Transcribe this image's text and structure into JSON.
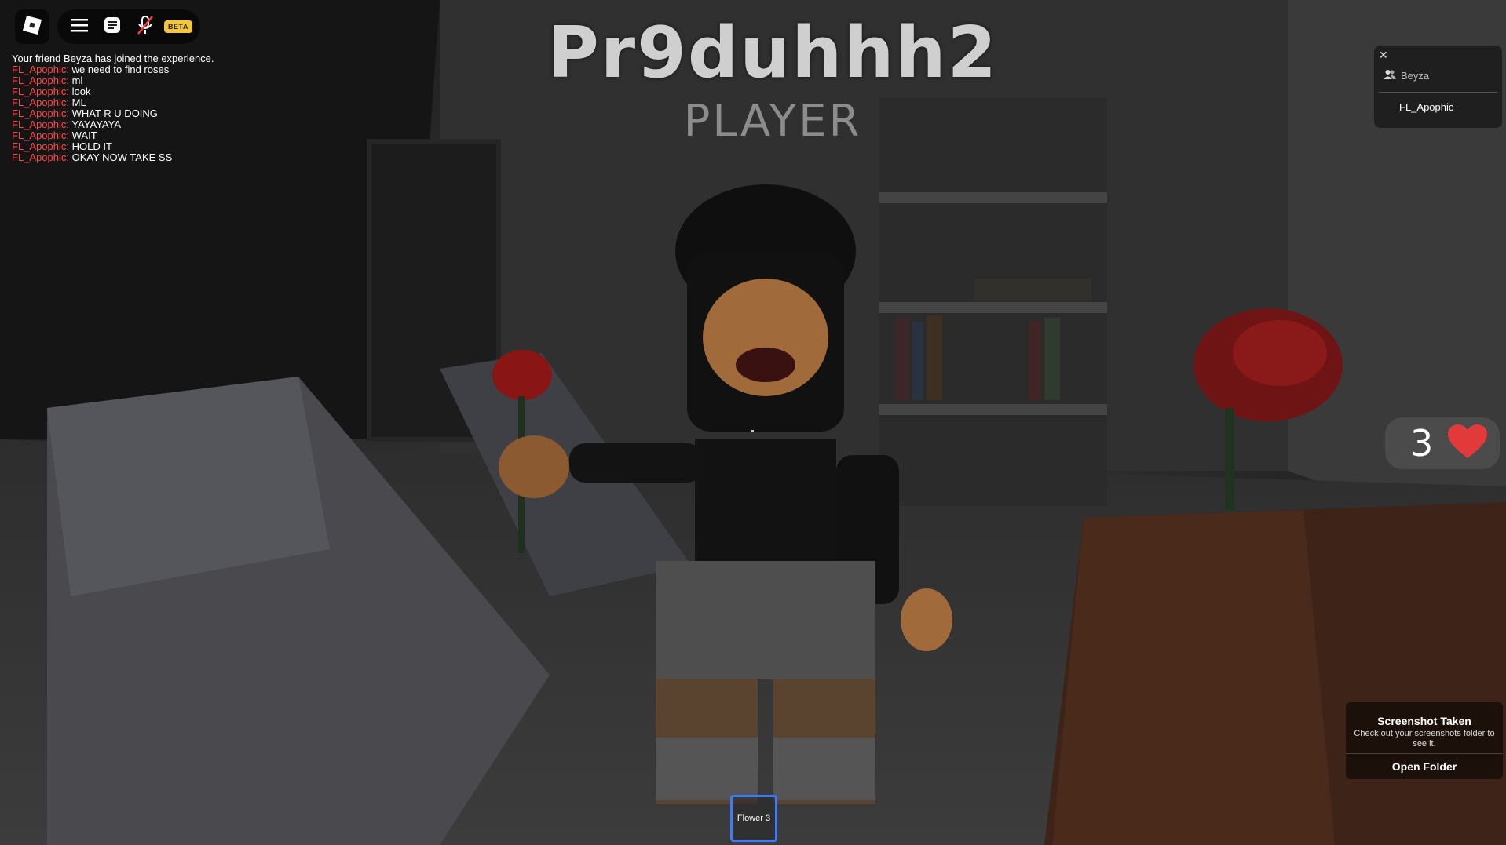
{
  "toolbar": {
    "beta_label": "BETA"
  },
  "title": {
    "main": "Pr9duhhh2",
    "sub": "PLAYER"
  },
  "chat": {
    "system_message": "Your friend Beyza has joined the experience.",
    "messages": [
      {
        "user": "FL_Apophic:",
        "text": "we need to find roses"
      },
      {
        "user": "FL_Apophic:",
        "text": "ml"
      },
      {
        "user": "FL_Apophic:",
        "text": "look"
      },
      {
        "user": "FL_Apophic:",
        "text": "ML"
      },
      {
        "user": "FL_Apophic:",
        "text": "WHAT R U DOING"
      },
      {
        "user": "FL_Apophic:",
        "text": "YAYAYAYA"
      },
      {
        "user": "FL_Apophic:",
        "text": "WAIT"
      },
      {
        "user": "FL_Apophic:",
        "text": "HOLD IT"
      },
      {
        "user": "FL_Apophic:",
        "text": "OKAY NOW TAKE SS"
      }
    ]
  },
  "players": {
    "friend": "Beyza",
    "self": "FL_Apophic"
  },
  "hearts": {
    "count": "3",
    "heart_color": "#e23a3a"
  },
  "toast": {
    "title": "Screenshot Taken",
    "body": "Check out your screenshots folder to see it.",
    "button": "Open Folder"
  },
  "hotbar": {
    "slot_label": "Flower 3",
    "selected_color": "#3a7bff"
  },
  "icons": {
    "logo": "roblox-logo-icon",
    "menu": "hamburger-menu-icon",
    "chat": "chat-icon",
    "mic": "microphone-muted-icon",
    "players": "people-icon",
    "close": "close-icon",
    "heart": "heart-icon"
  }
}
